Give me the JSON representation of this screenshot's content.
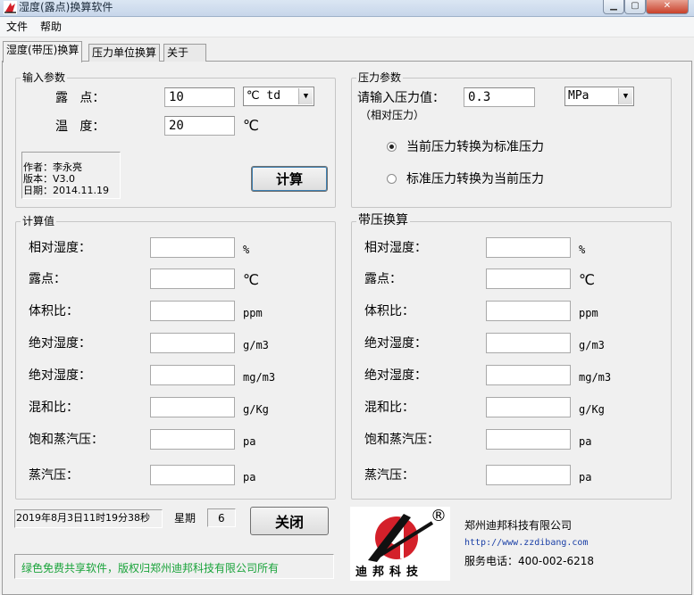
{
  "window": {
    "title": "湿度(露点)换算软件"
  },
  "menu": [
    "文件",
    "帮助"
  ],
  "tabs": [
    "湿度(带压)换算",
    "压力单位换算",
    "关于"
  ],
  "input_params": {
    "title": "输入参数",
    "dewpoint_label": "露   点：",
    "dewpoint_value": "10",
    "dewpoint_unit_selected": "℃ td",
    "temp_label": "温   度：",
    "temp_value": "20",
    "temp_unit": "℃",
    "author_line": "作者：李永亮",
    "version_line": "版本：V3.0",
    "date_line": "日期：2014.11.19",
    "calc_button": "计算"
  },
  "pressure_params": {
    "title": "压力参数",
    "input_label": "请输入压力值：",
    "value": "0.3",
    "unit_selected": "MPa",
    "relative_note": "（相对压力）",
    "option1": "当前压力转换为标准压力",
    "option2": "标准压力转换为当前压力",
    "selected_option": 1
  },
  "calc_values": {
    "title": "计算值",
    "rows": [
      {
        "label": "相对湿度：",
        "unit": "%"
      },
      {
        "label": "露点：",
        "unit": "℃"
      },
      {
        "label": "体积比：",
        "unit": "ppm"
      },
      {
        "label": "绝对湿度：",
        "unit": "g/m3"
      },
      {
        "label": "绝对湿度：",
        "unit": "mg/m3"
      },
      {
        "label": "混和比：",
        "unit": "g/Kg"
      },
      {
        "label": "饱和蒸汽压：",
        "unit": "pa"
      },
      {
        "label": "蒸汽压：",
        "unit": "pa"
      }
    ]
  },
  "pressure_calc": {
    "title": "带压换算",
    "rows": [
      {
        "label": "相对湿度：",
        "unit": "%"
      },
      {
        "label": "露点：",
        "unit": "℃"
      },
      {
        "label": "体积比：",
        "unit": "ppm"
      },
      {
        "label": "绝对湿度：",
        "unit": "g/m3"
      },
      {
        "label": "绝对湿度：",
        "unit": "mg/m3"
      },
      {
        "label": "混和比：",
        "unit": "g/Kg"
      },
      {
        "label": "饱和蒸汽压：",
        "unit": "pa"
      },
      {
        "label": "蒸汽压：",
        "unit": "pa"
      }
    ]
  },
  "footer": {
    "datetime": "2019年8月3日11时19分38秒",
    "weekday_label": "星期",
    "weekday_value": "6",
    "close_button": "关闭",
    "free_notice": "绿色免费共享软件，版权归郑州迪邦科技有限公司所有",
    "company_name": "郑州迪邦科技有限公司",
    "website": "http://www.zzdibang.com",
    "service_phone": "服务电话：400-002-6218",
    "logo_text": "迪邦科技",
    "registered_mark": "®"
  },
  "colors": {
    "accent_red": "#d4202a",
    "green_notice": "#19a33a",
    "link_blue": "#1a3fa6"
  }
}
